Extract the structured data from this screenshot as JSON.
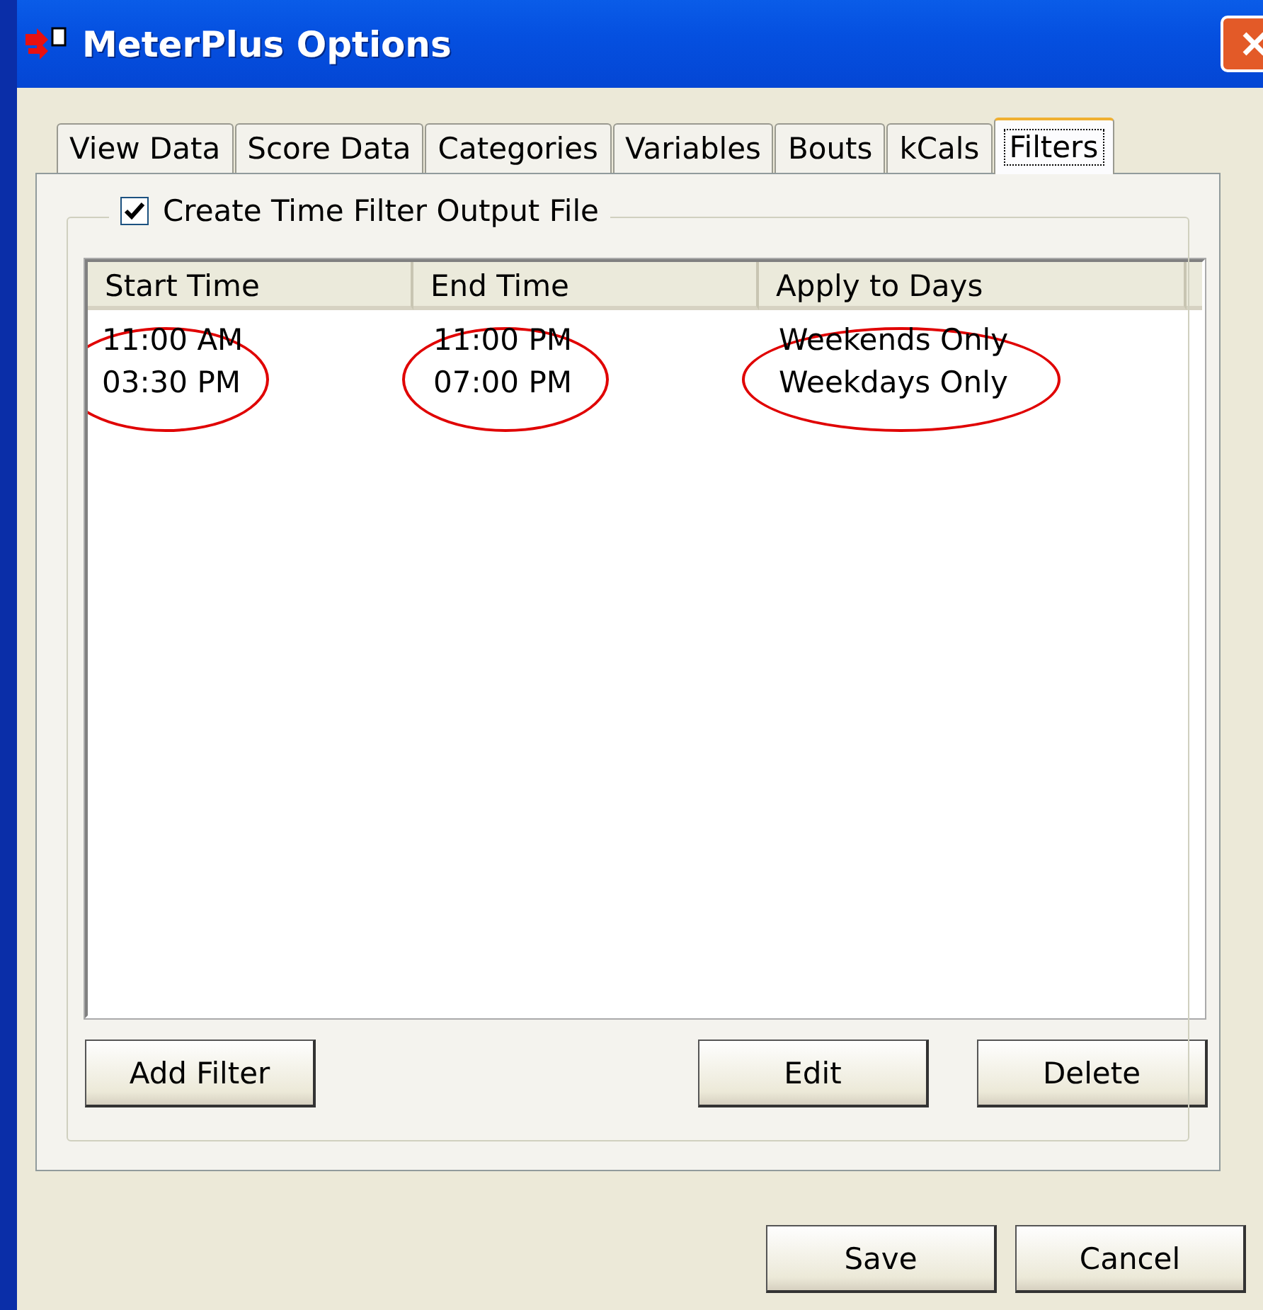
{
  "window": {
    "title": "MeterPlus Options"
  },
  "tabs": [
    {
      "label": "View Data",
      "selected": false
    },
    {
      "label": "Score Data",
      "selected": false
    },
    {
      "label": "Categories",
      "selected": false
    },
    {
      "label": "Variables",
      "selected": false
    },
    {
      "label": "Bouts",
      "selected": false
    },
    {
      "label": "kCals",
      "selected": false
    },
    {
      "label": "Filters",
      "selected": true
    }
  ],
  "group": {
    "label": "Create Time Filter Output File",
    "checked": true
  },
  "table": {
    "columns": [
      "Start Time",
      "End Time",
      "Apply to Days"
    ],
    "rows": [
      {
        "cells": [
          "11:00 AM",
          "11:00 PM",
          "Weekends Only"
        ],
        "circled": false
      },
      {
        "cells": [
          "03:30 PM",
          "07:00 PM",
          "Weekdays Only"
        ],
        "circled": true
      }
    ]
  },
  "group_buttons": [
    "Add Filter",
    "Edit",
    "Delete"
  ],
  "buttons": [
    "Save",
    "Cancel"
  ]
}
